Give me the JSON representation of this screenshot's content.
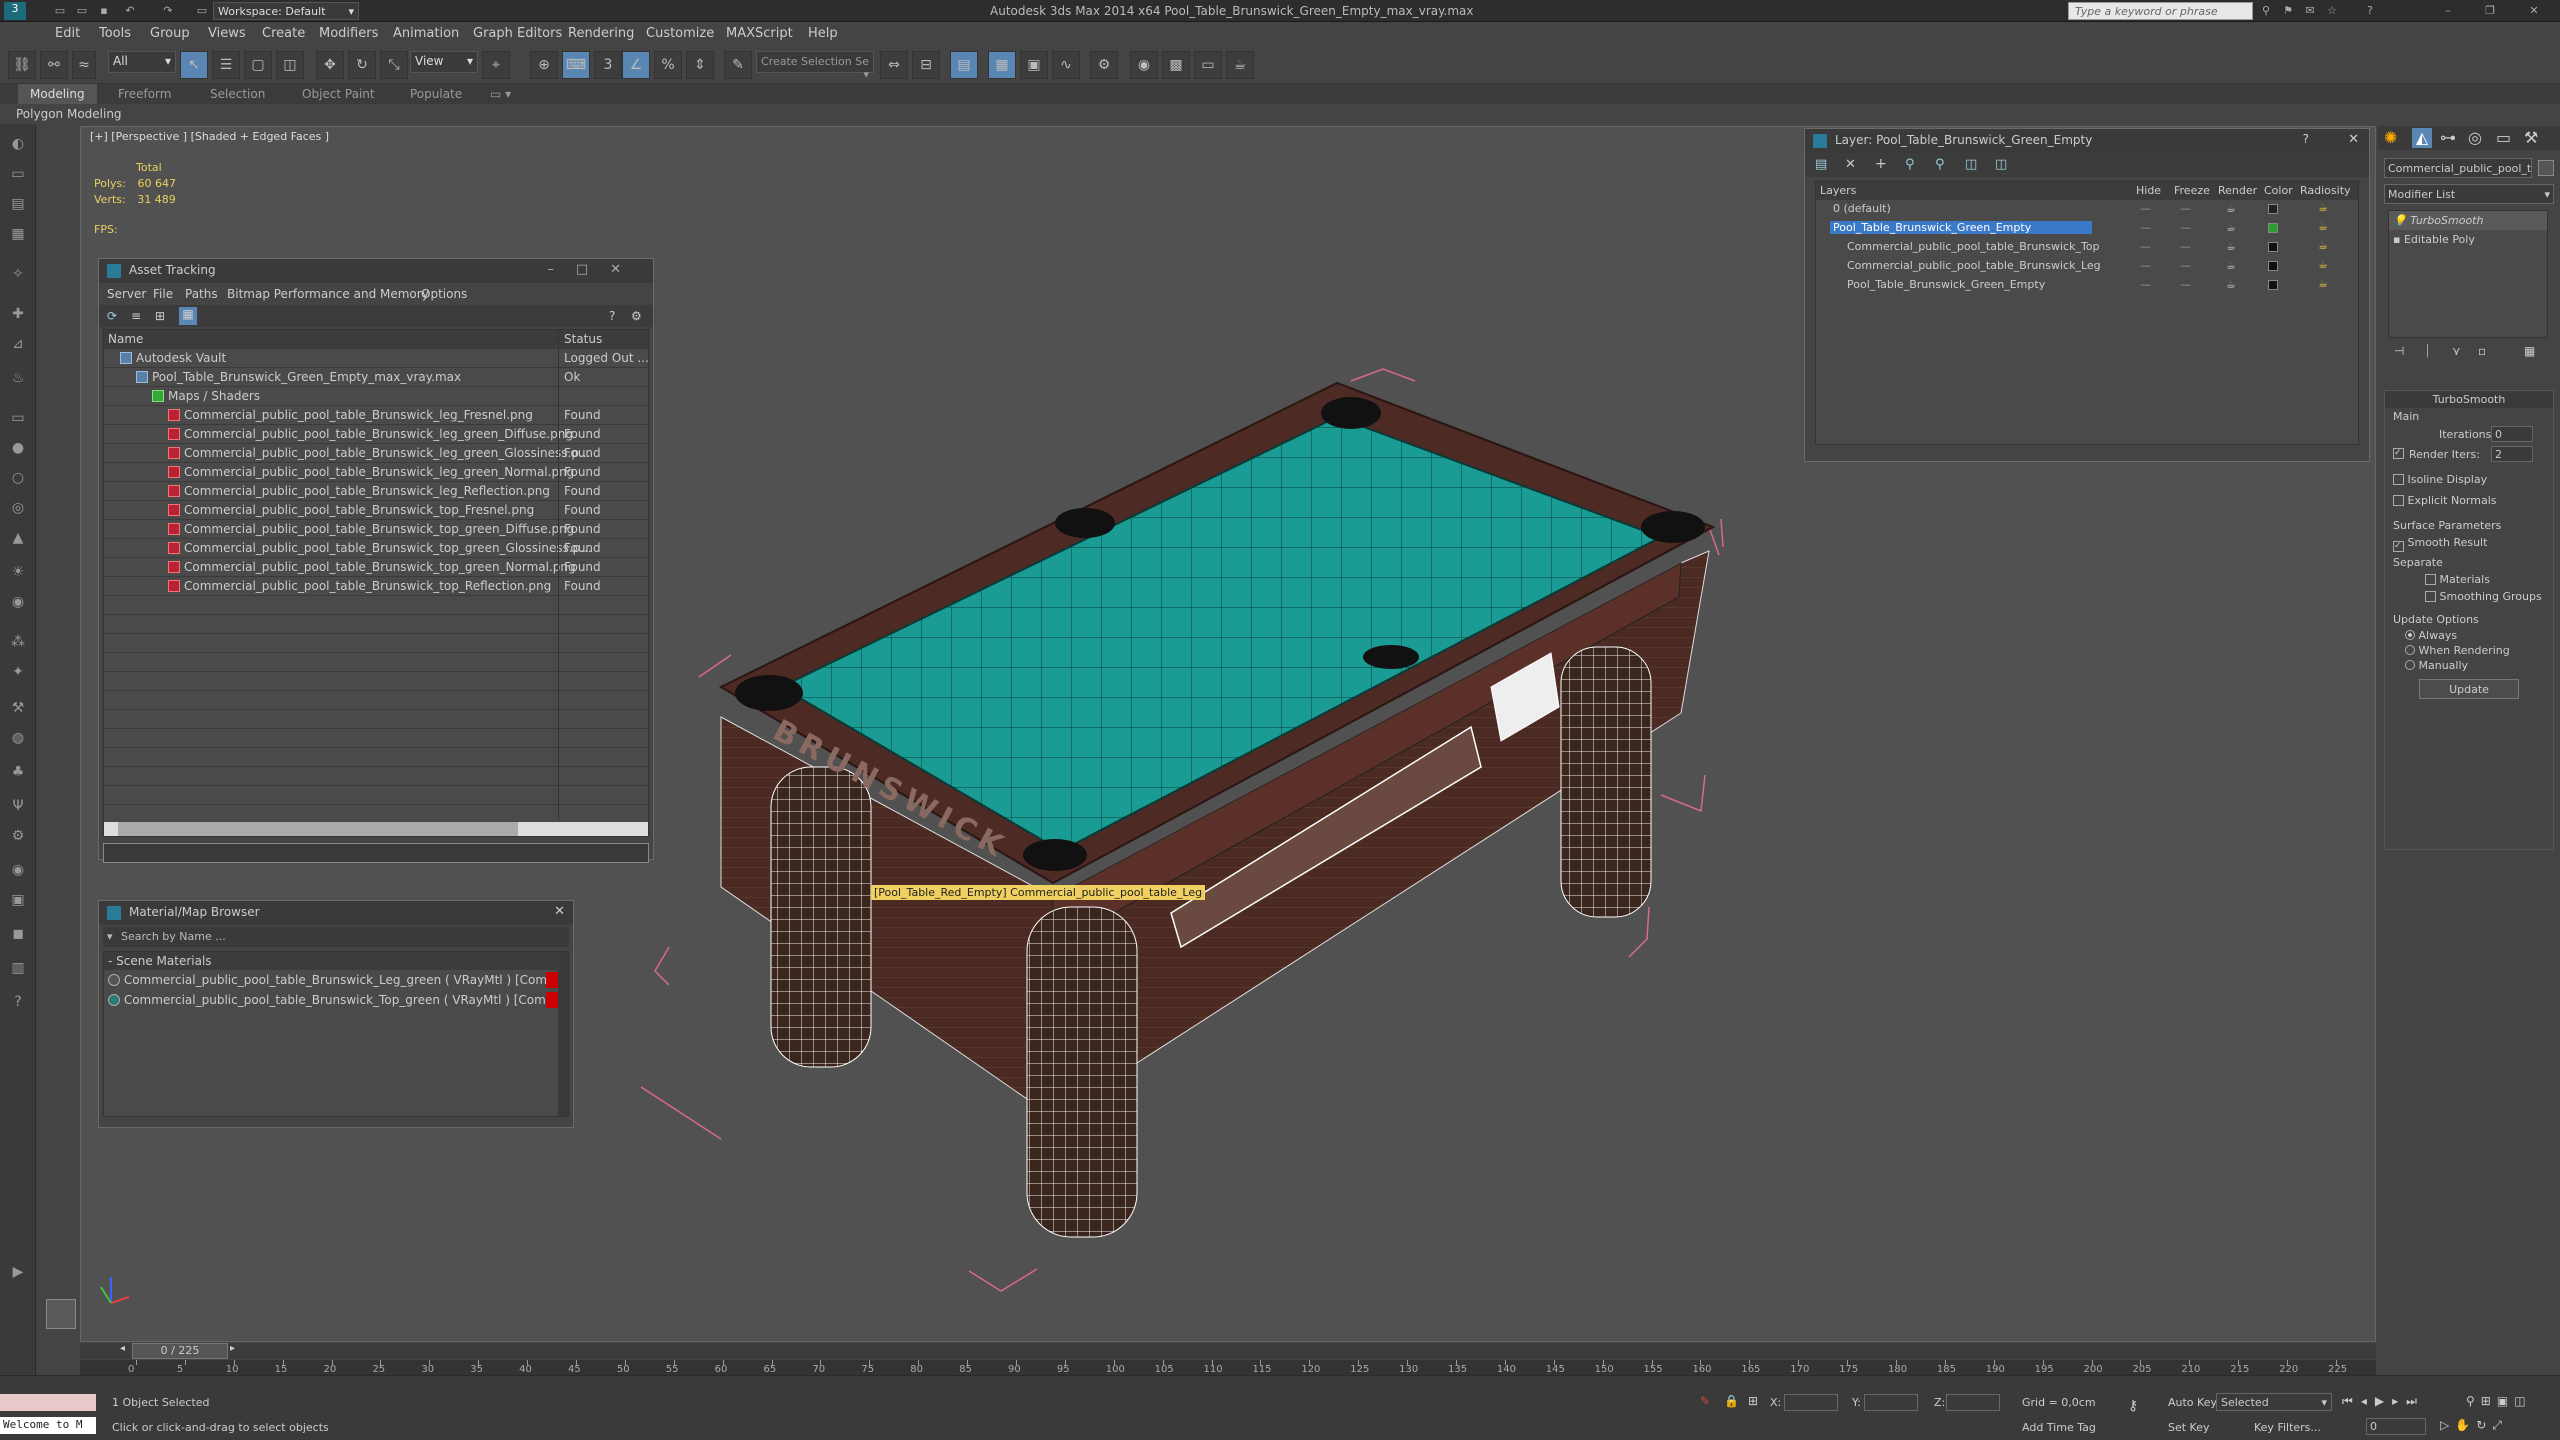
{
  "titlebar": {
    "app_title": "Autodesk 3ds Max  2014 x64      Pool_Table_Brunswick_Green_Empty_max_vray.max",
    "workspace": "Workspace: Default",
    "search_placeholder": "Type a keyword or phrase"
  },
  "menus": [
    "Edit",
    "Tools",
    "Group",
    "Views",
    "Create",
    "Modifiers",
    "Animation",
    "Graph Editors",
    "Rendering",
    "Customize",
    "MAXScript",
    "Help"
  ],
  "toolbar": {
    "filter": "All",
    "view": "View",
    "selection_set": "Create Selection Se"
  },
  "ribbon": {
    "tabs": [
      "Modeling",
      "Freeform",
      "Selection",
      "Object Paint",
      "Populate"
    ],
    "subtab": "Polygon Modeling"
  },
  "viewport": {
    "label": "[+] [Perspective ] [Shaded + Edged Faces ]",
    "stats_total": "Total",
    "polys_label": "Polys:",
    "polys_value": "60 647",
    "verts_label": "Verts:",
    "verts_value": "31 489",
    "fps_label": "FPS:",
    "tooltip": "[Pool_Table_Red_Empty] Commercial_public_pool_table_Leg",
    "brand": "BRUNSWICK"
  },
  "asset_tracking": {
    "title": "Asset Tracking",
    "menus": [
      "Server",
      "File",
      "Paths",
      "Bitmap Performance and Memory",
      "Options"
    ],
    "col_name": "Name",
    "col_status": "Status",
    "rows": [
      {
        "name": "Autodesk Vault",
        "status": "Logged Out ...",
        "indent": 1
      },
      {
        "name": "Pool_Table_Brunswick_Green_Empty_max_vray.max",
        "status": "Ok",
        "indent": 2
      },
      {
        "name": "Maps / Shaders",
        "status": "",
        "indent": 3
      },
      {
        "name": "Commercial_public_pool_table_Brunswick_leg_Fresnel.png",
        "status": "Found",
        "indent": 4
      },
      {
        "name": "Commercial_public_pool_table_Brunswick_leg_green_Diffuse.png",
        "status": "Found",
        "indent": 4
      },
      {
        "name": "Commercial_public_pool_table_Brunswick_leg_green_Glossiness.p...",
        "status": "Found",
        "indent": 4
      },
      {
        "name": "Commercial_public_pool_table_Brunswick_leg_green_Normal.png",
        "status": "Found",
        "indent": 4
      },
      {
        "name": "Commercial_public_pool_table_Brunswick_leg_Reflection.png",
        "status": "Found",
        "indent": 4
      },
      {
        "name": "Commercial_public_pool_table_Brunswick_top_Fresnel.png",
        "status": "Found",
        "indent": 4
      },
      {
        "name": "Commercial_public_pool_table_Brunswick_top_green_Diffuse.png",
        "status": "Found",
        "indent": 4
      },
      {
        "name": "Commercial_public_pool_table_Brunswick_top_green_Glossiness.p...",
        "status": "Found",
        "indent": 4
      },
      {
        "name": "Commercial_public_pool_table_Brunswick_top_green_Normal.png",
        "status": "Found",
        "indent": 4
      },
      {
        "name": "Commercial_public_pool_table_Brunswick_top_Reflection.png",
        "status": "Found",
        "indent": 4
      }
    ]
  },
  "material_browser": {
    "title": "Material/Map Browser",
    "search_placeholder": "Search by Name ...",
    "group": "Scene Materials",
    "items": [
      "Commercial_public_pool_table_Brunswick_Leg_green ( VRayMtl ) [Commercial_...",
      "Commercial_public_pool_table_Brunswick_Top_green ( VRayMtl ) [Commercial_..."
    ]
  },
  "layers": {
    "title": "Layer: Pool_Table_Brunswick_Green_Empty",
    "cols": [
      "Layers",
      "Hide",
      "Freeze",
      "Render",
      "Color",
      "Radiosity"
    ],
    "rows": [
      {
        "name": "0 (default)",
        "color": "#222222",
        "selected": false,
        "indent": 1
      },
      {
        "name": "Pool_Table_Brunswick_Green_Empty",
        "color": "#2aa02a",
        "selected": true,
        "indent": 1
      },
      {
        "name": "Commercial_public_pool_table_Brunswick_Top",
        "color": "#111111",
        "selected": false,
        "indent": 2
      },
      {
        "name": "Commercial_public_pool_table_Brunswick_Leg",
        "color": "#111111",
        "selected": false,
        "indent": 2
      },
      {
        "name": "Pool_Table_Brunswick_Green_Empty",
        "color": "#111111",
        "selected": false,
        "indent": 2
      }
    ]
  },
  "command_panel": {
    "object_name": "Commercial_public_pool_table",
    "modifier_list": "Modifier List",
    "stack": [
      "TurboSmooth",
      "Editable Poly"
    ],
    "rollout": "TurboSmooth",
    "main": "Main",
    "iterations_label": "Iterations:",
    "iterations": "0",
    "render_iters_label": "Render Iters:",
    "render_iters": "2",
    "isoline": "Isoline Display",
    "explicit": "Explicit Normals",
    "surface": "Surface Parameters",
    "smooth_result": "Smooth Result",
    "separate": "Separate",
    "materials": "Materials",
    "smoothing_groups": "Smoothing Groups",
    "update_options": "Update Options",
    "always": "Always",
    "when_rendering": "When Rendering",
    "manually": "Manually",
    "update": "Update"
  },
  "timeline": {
    "frame": "0 / 225",
    "ticks": [
      "0",
      "5",
      "10",
      "15",
      "20",
      "25",
      "30",
      "35",
      "40",
      "45",
      "50",
      "55",
      "60",
      "65",
      "70",
      "75",
      "80",
      "85",
      "90",
      "95",
      "100",
      "105",
      "110",
      "115",
      "120",
      "125",
      "130",
      "135",
      "140",
      "145",
      "150",
      "155",
      "160",
      "165",
      "170",
      "175",
      "180",
      "185",
      "190",
      "195",
      "200",
      "205",
      "210",
      "215",
      "220",
      "225"
    ]
  },
  "status": {
    "selected": "1 Object Selected",
    "prompt": "Click or click-and-drag to select objects",
    "welcome": "Welcome to M",
    "x": "X:",
    "y": "Y:",
    "z": "Z:",
    "grid": "Grid = 0,0cm",
    "auto_key": "Auto Key",
    "selected_dd": "Selected",
    "set_key": "Set Key",
    "key_filters": "Key Filters...",
    "add_time_tag": "Add Time Tag",
    "frame_field": "0"
  }
}
